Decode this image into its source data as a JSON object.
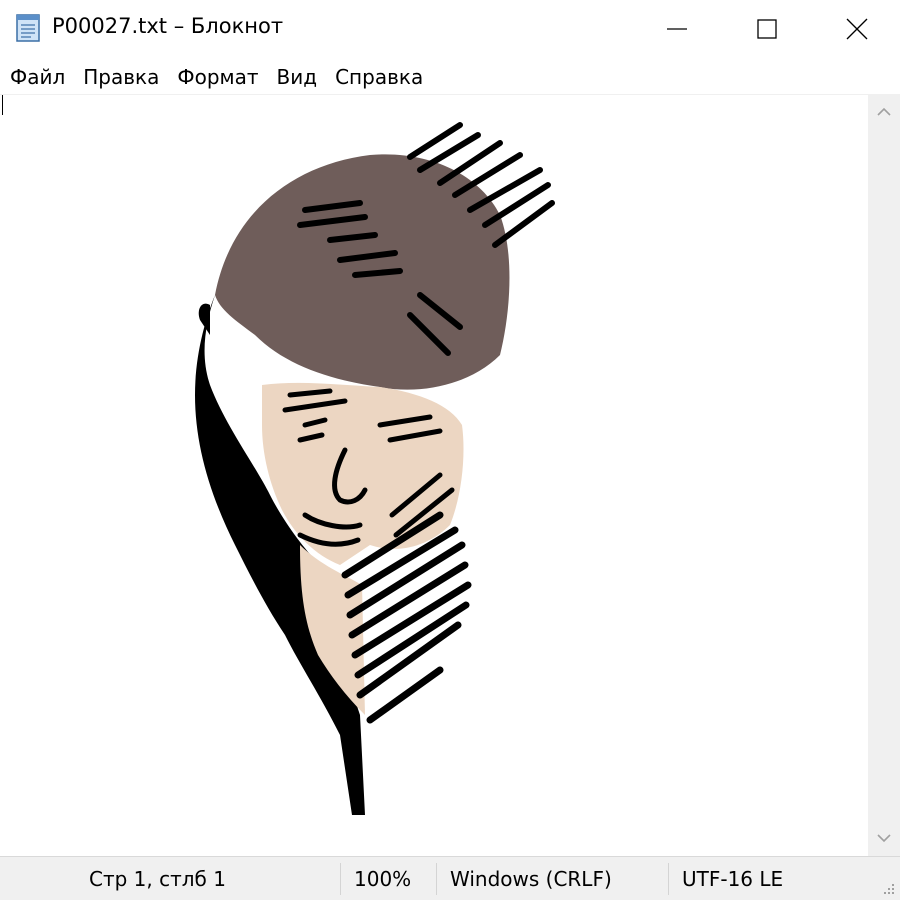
{
  "window": {
    "title": "P00027.txt – Блокнот",
    "icon": "notepad-icon"
  },
  "controls": {
    "minimize_icon": "minimize-icon",
    "maximize_icon": "maximize-icon",
    "close_icon": "close-icon"
  },
  "menu": {
    "items": [
      {
        "label": "Файл"
      },
      {
        "label": "Правка"
      },
      {
        "label": "Формат"
      },
      {
        "label": "Вид"
      },
      {
        "label": "Справка"
      }
    ]
  },
  "editor": {
    "content_description_icon": "ascii-art-portrait",
    "colors": {
      "hair": "#6f5d5a",
      "skin": "#ecd6c2",
      "ink": "#000000"
    }
  },
  "status": {
    "position": "Стр 1, стлб 1",
    "zoom": "100%",
    "line_endings": "Windows (CRLF)",
    "encoding": "UTF-16 LE"
  }
}
